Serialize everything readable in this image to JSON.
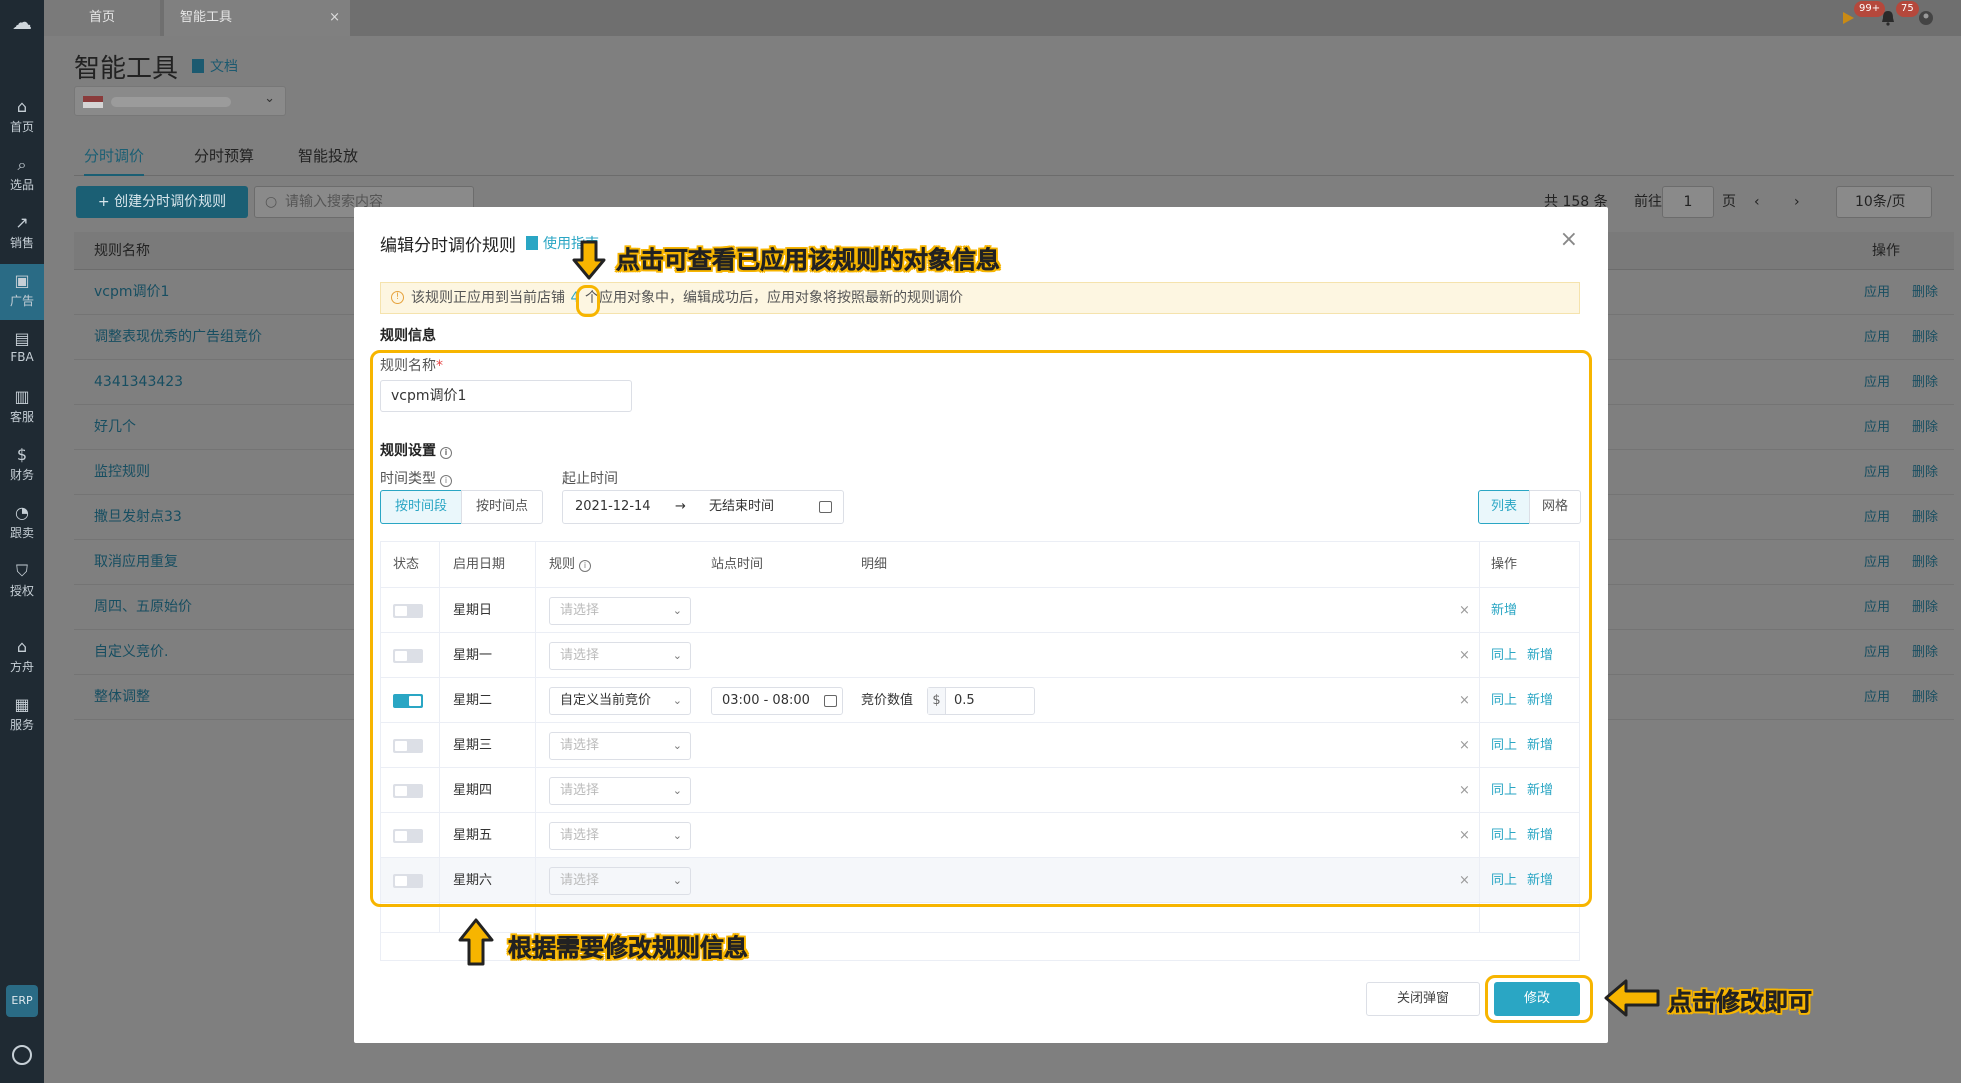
{
  "top_tabs": {
    "home": "首页",
    "tool": "智能工具",
    "close": "×"
  },
  "header_badges": {
    "notify_a": "99+",
    "notify_b": "75"
  },
  "sidebar": {
    "items": [
      {
        "label": "首页",
        "icon": "house-icon"
      },
      {
        "label": "选品",
        "icon": "search-icon"
      },
      {
        "label": "销售",
        "icon": "chart-icon"
      },
      {
        "label": "广告",
        "icon": "ad-icon"
      },
      {
        "label": "FBA",
        "icon": "box-icon"
      },
      {
        "label": "客服",
        "icon": "stats-icon"
      },
      {
        "label": "财务",
        "icon": "dollar-icon"
      },
      {
        "label": "跟卖",
        "icon": "pie-icon"
      },
      {
        "label": "授权",
        "icon": "shield-icon"
      },
      {
        "label": "方舟",
        "icon": "ship-icon"
      },
      {
        "label": "服务",
        "icon": "store-icon"
      }
    ],
    "erp": "ERP"
  },
  "page": {
    "title": "智能工具",
    "doc_link": "文档",
    "tabs": [
      "分时调价",
      "分时预算",
      "智能投放"
    ],
    "create_button": "+ 创建分时调价规则",
    "search_placeholder": "请输入搜索内容",
    "total": "共 158 条",
    "goto": "前往",
    "page_num": "1",
    "page_unit": "页",
    "page_size": "10条/页",
    "col_rule_name": "规则名称",
    "col_ops": "操作",
    "rows": [
      "vcpm调价1",
      "调整表现优秀的广告组竞价",
      "4341343423",
      "好几个",
      "监控规则",
      "撒旦发射点33",
      "取消应用重复",
      "周四、五原始价",
      "自定义竞价.",
      "整体调整"
    ],
    "op_apply": "应用",
    "op_delete": "删除"
  },
  "modal": {
    "title": "编辑分时调价规则",
    "guide_link": "使用指南",
    "notice_before": "该规则正应用到当前店铺",
    "notice_count": "4",
    "notice_after": "个应用对象中，编辑成功后，应用对象将按照最新的规则调价",
    "section_info": "规则信息",
    "name_label": "规则名称",
    "name_required": "*",
    "name_value": "vcpm调价1",
    "section_settings": "规则设置",
    "time_type_label": "时间类型",
    "time_type_options": [
      "按时间段",
      "按时间点"
    ],
    "date_label": "起止时间",
    "date_start": "2021-12-14",
    "date_arrow": "→",
    "date_end": "无结束时间",
    "view_options": [
      "列表",
      "网格"
    ],
    "table_headers": {
      "status": "状态",
      "date": "启用日期",
      "rule": "规则",
      "site_time": "站点时间",
      "detail": "明细",
      "ops": "操作"
    },
    "rows": [
      {
        "day": "星期日",
        "on": false,
        "rule": "请选择",
        "same": "",
        "add": "新增"
      },
      {
        "day": "星期一",
        "on": false,
        "rule": "请选择",
        "same": "同上",
        "add": "新增"
      },
      {
        "day": "星期二",
        "on": true,
        "rule": "自定义当前竞价",
        "time": "03:00 - 08:00",
        "bid_label": "竞价数值",
        "currency": "$",
        "bid_value": "0.5",
        "same": "同上",
        "add": "新增"
      },
      {
        "day": "星期三",
        "on": false,
        "rule": "请选择",
        "same": "同上",
        "add": "新增"
      },
      {
        "day": "星期四",
        "on": false,
        "rule": "请选择",
        "same": "同上",
        "add": "新增"
      },
      {
        "day": "星期五",
        "on": false,
        "rule": "请选择",
        "same": "同上",
        "add": "新增"
      },
      {
        "day": "星期六",
        "on": false,
        "rule": "请选择",
        "same": "同上",
        "add": "新增"
      }
    ],
    "delete_mark": "×",
    "close_button": "关闭弹窗",
    "submit_button": "修改"
  },
  "annotations": {
    "top": "点击可查看已应用该规则的对象信息",
    "middle": "根据需要修改规则信息",
    "right": "点击修改即可"
  },
  "colors": {
    "accent": "#2aa6c4",
    "highlight": "#f7b500",
    "sidebar": "#1f2a33"
  }
}
